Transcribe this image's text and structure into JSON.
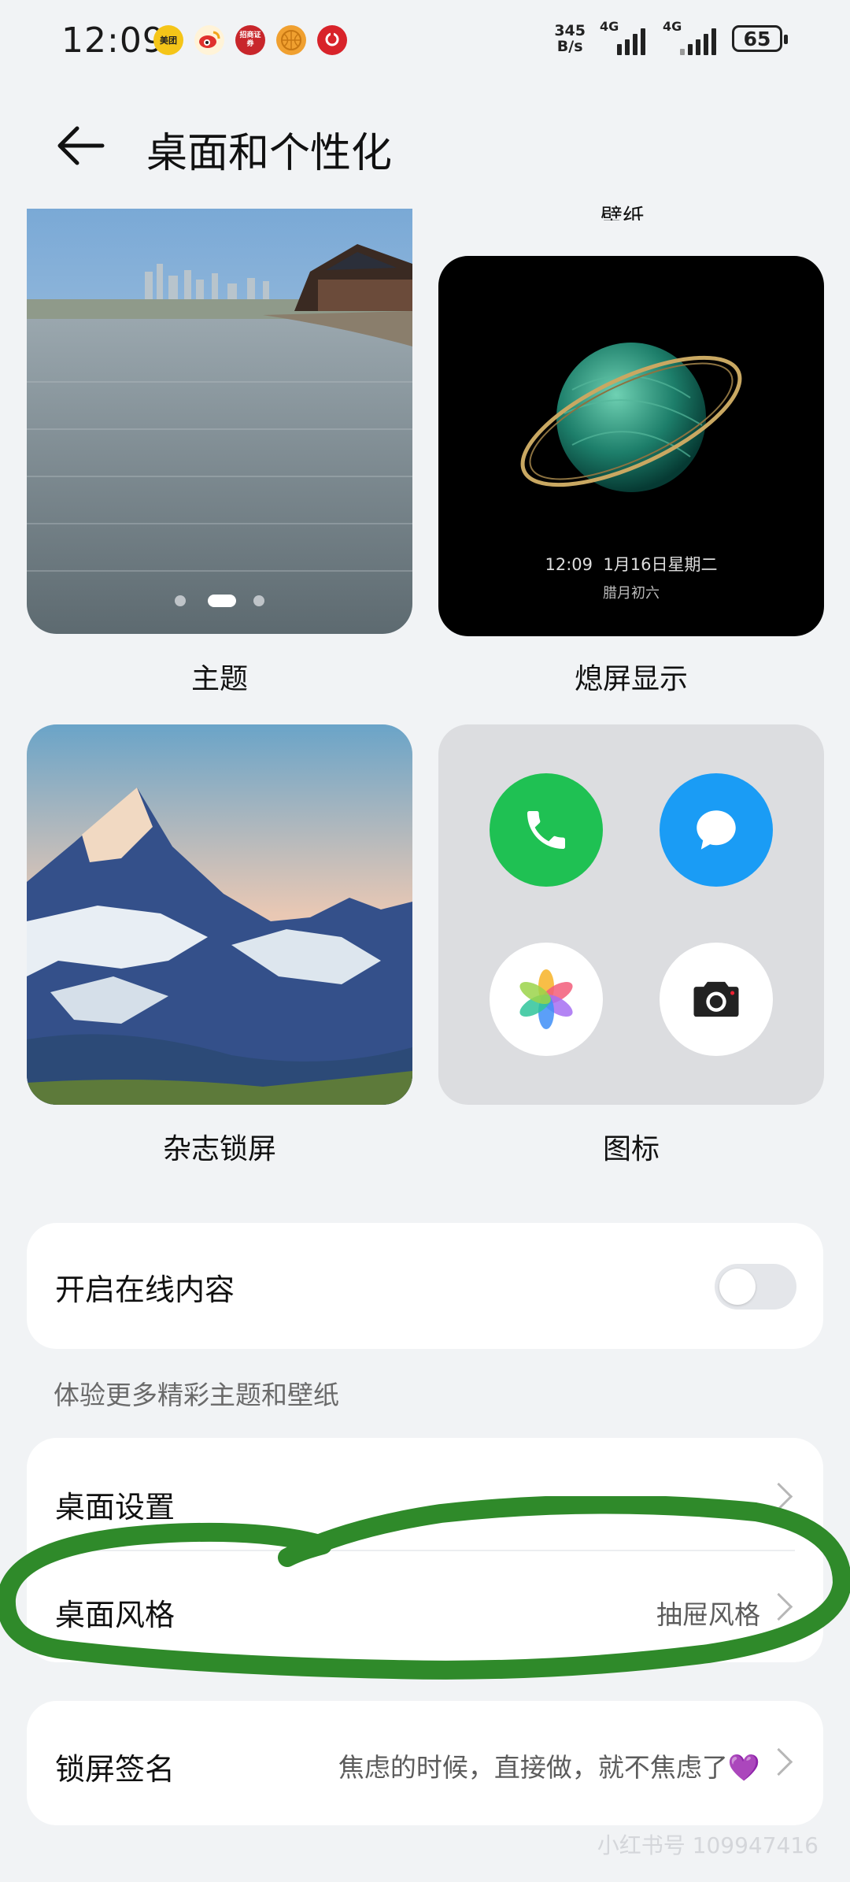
{
  "status_bar": {
    "time": "12:09",
    "apps": [
      {
        "name": "meituan-icon",
        "label": "美团",
        "color": "#f5c518"
      },
      {
        "name": "weibo-icon",
        "label": "",
        "color": "#f2a31b"
      },
      {
        "name": "zhaoshang-securities-icon",
        "label": "招商证券",
        "color": "#c8262b"
      },
      {
        "name": "basketball-app-icon",
        "label": "",
        "color": "#f0a030"
      },
      {
        "name": "red-app-icon",
        "label": "",
        "color": "#d8232a"
      }
    ],
    "net_speed_value": "345",
    "net_speed_unit": "B/s",
    "signal1_label": "4G",
    "signal2_label": "4G",
    "battery": "65"
  },
  "header": {
    "title": "桌面和个性化"
  },
  "wallpaper_label": "壁纸",
  "cards": {
    "theme": {
      "label": "主题"
    },
    "aod": {
      "label": "熄屏显示",
      "time": "12:09",
      "date": "1月16日星期二",
      "lunar": "腊月初六"
    },
    "magazine": {
      "label": "杂志锁屏"
    },
    "icons": {
      "label": "图标"
    }
  },
  "online_content": {
    "label": "开启在线内容",
    "enabled": false,
    "hint": "体验更多精彩主题和壁纸"
  },
  "settings": [
    {
      "label": "桌面设置",
      "value": ""
    },
    {
      "label": "桌面风格",
      "value": "抽屉风格"
    }
  ],
  "lock_signature": {
    "label": "锁屏签名",
    "value": "焦虑的时候，直接做，就不焦虑了💜"
  },
  "watermark": "小红书号 109947416",
  "colors": {
    "annotation_circle": "#2f8a2a",
    "phone_green": "#1fc153",
    "message_blue": "#1a9cf5"
  }
}
